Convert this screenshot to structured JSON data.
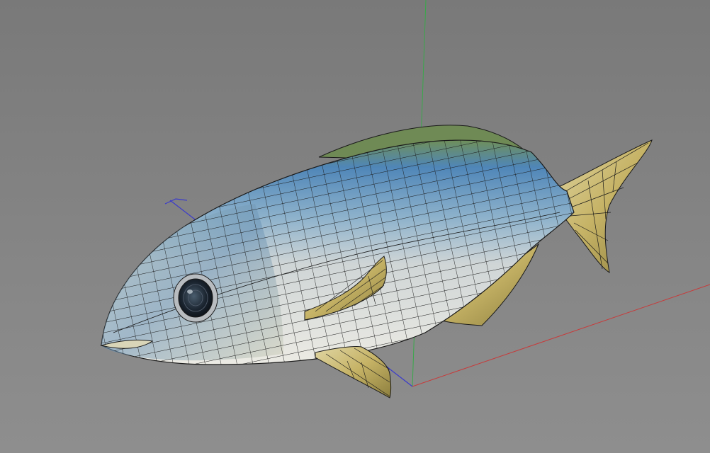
{
  "viewport": {
    "background": [
      "#797979",
      "#8e8e8e"
    ],
    "mode": "wireframe-on-shaded"
  },
  "axes": {
    "x_color": "#c83a3a",
    "y_color": "#39a84a",
    "z_color": "#3a3acc"
  },
  "model": {
    "type": "fish",
    "wireframe_color": "#1a1a1a",
    "colors": {
      "back": "#4f86b8",
      "flank": "#cfd5d6",
      "belly": "#ecebe4",
      "fins": "#c6b366",
      "head": "#8aa7a6",
      "eye": "#1b2530"
    }
  }
}
